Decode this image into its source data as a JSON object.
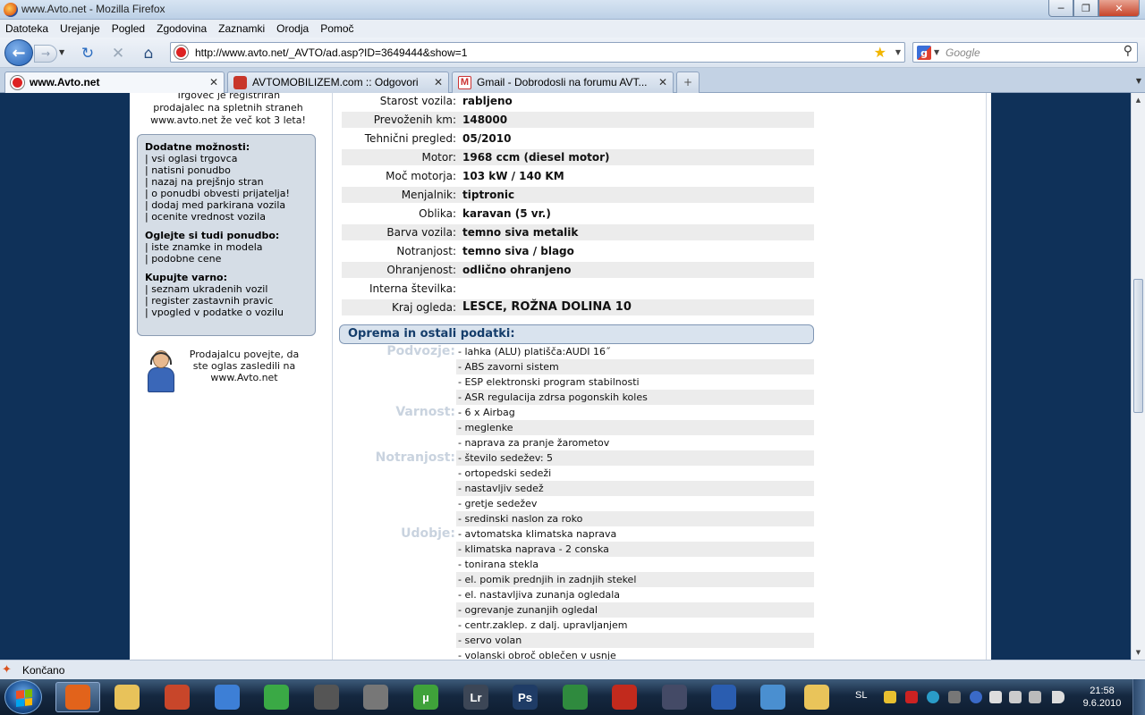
{
  "window": {
    "title": "www.Avto.net - Mozilla Firefox",
    "controls": [
      "─",
      "❐",
      "✕"
    ]
  },
  "menu": [
    "Datoteka",
    "Urejanje",
    "Pogled",
    "Zgodovina",
    "Zaznamki",
    "Orodja",
    "Pomoč"
  ],
  "toolbar": {
    "url": "http://www.avto.net/_AVTO/ad.asp?ID=3649444&show=1",
    "search_placeholder": "Google"
  },
  "tabs": [
    {
      "label": "www.Avto.net",
      "active": true,
      "close": "✕"
    },
    {
      "label": "AVTOMOBILIZEM.com :: Odgovori",
      "active": false,
      "close": "✕"
    },
    {
      "label": "Gmail - Dobrodosli na forumu AVT...",
      "active": false,
      "close": "✕"
    }
  ],
  "sidebar": {
    "note_lines": [
      "Trgovec je registriran",
      "prodajalec na spletnih straneh",
      "www.avto.net že več kot 3 leta!"
    ],
    "options": {
      "groups": [
        {
          "title": "Dodatne možnosti:",
          "items": [
            "| vsi oglasi trgovca",
            "| natisni ponudbo",
            "| nazaj na prejšnjo stran",
            "| o ponudbi obvesti prijatelja!",
            "| dodaj med parkirana vozila",
            "| ocenite vrednost vozila"
          ]
        },
        {
          "title": "Oglejte si tudi ponudbo:",
          "items": [
            "| iste znamke in modela",
            "| podobne cene"
          ]
        },
        {
          "title": "Kupujte varno:",
          "items": [
            "| seznam ukradenih vozil",
            "| register zastavnih pravic",
            "| vpogled v podatke o vozilu"
          ]
        }
      ]
    },
    "seller_lines": [
      "Prodajalcu povejte, da",
      "ste oglas zasledili na",
      "www.Avto.net"
    ]
  },
  "specs": [
    {
      "label": "Starost vozila:",
      "value": "rabljeno"
    },
    {
      "label": "Prevoženih km:",
      "value": "148000"
    },
    {
      "label": "Tehnični pregled:",
      "value": "05/2010"
    },
    {
      "label": "Motor:",
      "value": "1968 ccm (diesel motor)"
    },
    {
      "label": "Moč motorja:",
      "value": "103 kW  / 140 KM"
    },
    {
      "label": "Menjalnik:",
      "value": "tiptronic"
    },
    {
      "label": "Oblika:",
      "value": "karavan (5 vr.)"
    },
    {
      "label": "Barva vozila:",
      "value": "temno siva metalik"
    },
    {
      "label": "Notranjost:",
      "value": "temno siva / blago"
    },
    {
      "label": "Ohranjenost:",
      "value": "odlično ohranjeno"
    },
    {
      "label": "Interna številka:",
      "value": ""
    },
    {
      "label": "Kraj ogleda:",
      "value": "LESCE, ROŽNA DOLINA 10"
    }
  ],
  "equipment": {
    "header": "Oprema in ostali podatki:",
    "categories": [
      {
        "name": "Podvozje:",
        "items": [
          "- lahka (ALU) platišča:AUDI 16˝",
          "- ABS zavorni sistem",
          "- ESP elektronski program stabilnosti",
          "- ASR regulacija zdrsa pogonskih koles"
        ]
      },
      {
        "name": "Varnost:",
        "items": [
          "- 6 x Airbag",
          "- meglenke",
          "- naprava za pranje žarometov"
        ]
      },
      {
        "name": "Notranjost:",
        "items": [
          "- število sedežev: 5",
          "- ortopedski sedeži",
          "- nastavljiv sedež",
          "- gretje sedežev",
          "- sredinski naslon za roko"
        ]
      },
      {
        "name": "Udobje:",
        "items": [
          "- avtomatska klimatska naprava",
          "- klimatska naprava - 2 conska",
          "- tonirana stekla",
          "- el. pomik prednjih in zadnjih stekel",
          "- el. nastavljiva zunanja ogledala",
          "- ogrevanje zunanjih ogledal",
          "- centr.zaklep. z dalj. upravljanjem",
          "- servo volan",
          "- volanski obroč oblečen v usnje"
        ]
      }
    ]
  },
  "status": {
    "text": "Končano"
  },
  "taskbar": {
    "items": [
      {
        "icon": "firefox-icon",
        "color": "#e2631b",
        "label": "",
        "active": true
      },
      {
        "icon": "explorer-icon",
        "color": "#e8c25a",
        "label": ""
      },
      {
        "icon": "app-icon",
        "color": "#c8462a",
        "label": ""
      },
      {
        "icon": "tools-icon",
        "color": "#3d7fd6",
        "label": ""
      },
      {
        "icon": "shield-icon",
        "color": "#3aa945",
        "label": ""
      },
      {
        "icon": "film-icon",
        "color": "#555555",
        "label": ""
      },
      {
        "icon": "reel-icon",
        "color": "#777777",
        "label": ""
      },
      {
        "icon": "utorrent-icon",
        "color": "#3fa23a",
        "label": "µ"
      },
      {
        "icon": "lightroom-icon",
        "color": "#3c4656",
        "label": "Lr"
      },
      {
        "icon": "photoshop-icon",
        "color": "#1f3c66",
        "label": "Ps"
      },
      {
        "icon": "maps-icon",
        "color": "#2f8a3e",
        "label": ""
      },
      {
        "icon": "red-app-icon",
        "color": "#c22a1d",
        "label": ""
      },
      {
        "icon": "car-game-icon",
        "color": "#444a66",
        "label": ""
      },
      {
        "icon": "google-earth-icon",
        "color": "#2a5db0",
        "label": ""
      },
      {
        "icon": "messenger-icon",
        "color": "#4a8fd0",
        "label": ""
      },
      {
        "icon": "mail-icon",
        "color": "#e9c45a",
        "label": ""
      }
    ],
    "lang": "SL",
    "time": "21:58",
    "date": "9.6.2010"
  }
}
